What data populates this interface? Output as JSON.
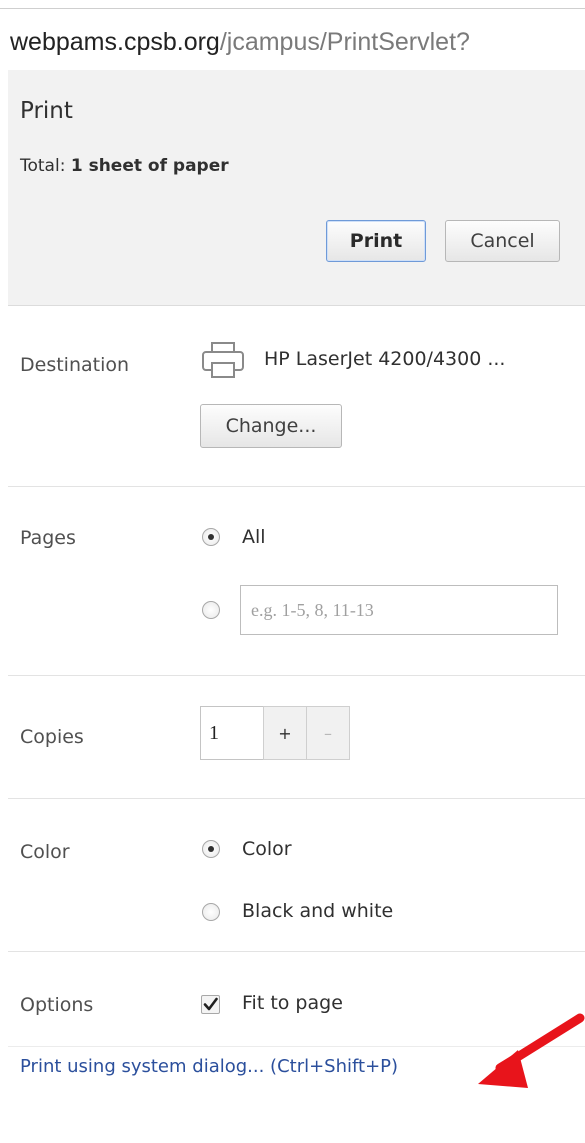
{
  "url": {
    "host": "webpams.cpsb.org",
    "path": "/jcampus/PrintServlet?"
  },
  "header": {
    "title": "Print",
    "total_label": "Total:",
    "total_value": "1 sheet of paper",
    "print_button": "Print",
    "cancel_button": "Cancel"
  },
  "destination": {
    "label": "Destination",
    "printer_name": "HP LaserJet 4200/4300 ...",
    "change_button": "Change...",
    "icon": "printer-icon"
  },
  "pages": {
    "label": "Pages",
    "options": [
      {
        "label": "All",
        "selected": true
      },
      {
        "label": "",
        "selected": false
      }
    ],
    "range_placeholder": "e.g. 1-5, 8, 11-13"
  },
  "copies": {
    "label": "Copies",
    "value": "1",
    "plus": "+",
    "minus": "–"
  },
  "color": {
    "label": "Color",
    "options": [
      {
        "label": "Color",
        "selected": true
      },
      {
        "label": "Black and white",
        "selected": false
      }
    ]
  },
  "options": {
    "label": "Options",
    "fit_to_page": {
      "label": "Fit to page",
      "checked": true
    }
  },
  "system_dialog_link": "Print using system dialog... (Ctrl+Shift+P)",
  "colors": {
    "link": "#2b4f9c",
    "annotation_arrow": "#e8141b",
    "header_bg": "#f2f2f2"
  }
}
